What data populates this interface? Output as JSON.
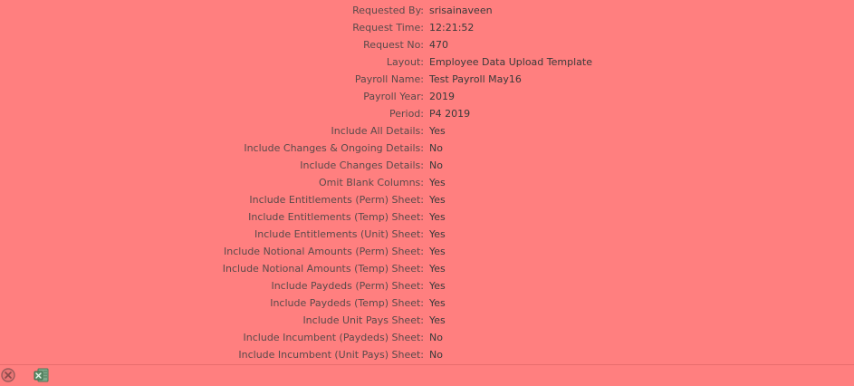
{
  "details": {
    "rows": [
      {
        "label": "Requested By:",
        "value": "srisainaveen"
      },
      {
        "label": "Request Time:",
        "value": "12:21:52"
      },
      {
        "label": "Request No:",
        "value": "470"
      },
      {
        "label": "Layout:",
        "value": "Employee Data Upload Template"
      },
      {
        "label": "Payroll Name:",
        "value": "Test Payroll May16"
      },
      {
        "label": "Payroll Year:",
        "value": "2019"
      },
      {
        "label": "Period:",
        "value": "P4 2019"
      },
      {
        "label": "Include All Details:",
        "value": "Yes"
      },
      {
        "label": "Include Changes & Ongoing Details:",
        "value": "No"
      },
      {
        "label": "Include Changes Details:",
        "value": "No"
      },
      {
        "label": "Omit Blank Columns:",
        "value": "Yes"
      },
      {
        "label": "Include Entitlements (Perm) Sheet:",
        "value": "Yes"
      },
      {
        "label": "Include Entitlements (Temp) Sheet:",
        "value": "Yes"
      },
      {
        "label": "Include Entitlements (Unit) Sheet:",
        "value": "Yes"
      },
      {
        "label": "Include Notional Amounts (Perm) Sheet:",
        "value": "Yes"
      },
      {
        "label": "Include Notional Amounts (Temp) Sheet:",
        "value": "Yes"
      },
      {
        "label": "Include Paydeds (Perm) Sheet:",
        "value": "Yes"
      },
      {
        "label": "Include Paydeds (Temp) Sheet:",
        "value": "Yes"
      },
      {
        "label": "Include Unit Pays Sheet:",
        "value": "Yes"
      },
      {
        "label": "Include Incumbent (Paydeds) Sheet:",
        "value": "No"
      },
      {
        "label": "Include Incumbent (Unit Pays) Sheet:",
        "value": "No"
      }
    ]
  },
  "toolbar": {
    "icons": [
      "cancel-icon",
      "excel-export-icon"
    ]
  },
  "colors": {
    "background": "#ff7f7f",
    "label_text": "#5a4a4a",
    "value_text": "#3a3a3a"
  }
}
